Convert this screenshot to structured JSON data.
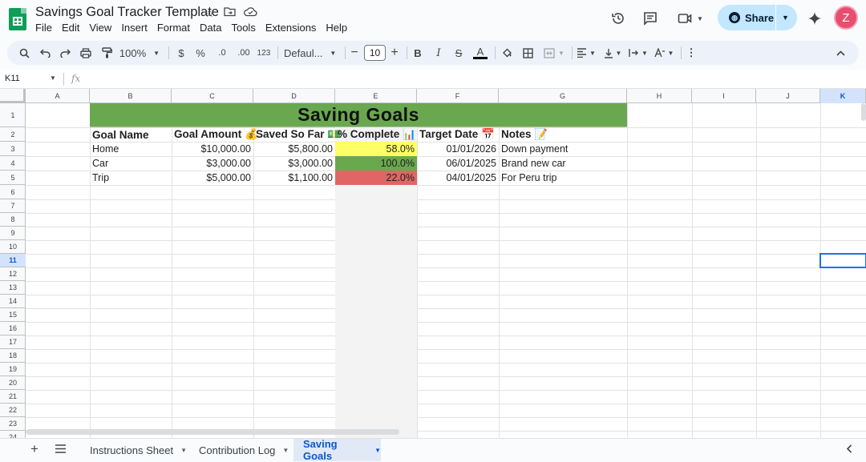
{
  "header": {
    "doc_title": "Savings Goal Tracker Template",
    "menu": [
      "File",
      "Edit",
      "View",
      "Insert",
      "Format",
      "Data",
      "Tools",
      "Extensions",
      "Help"
    ],
    "share_label": "Share",
    "avatar_initial": "Z"
  },
  "toolbar": {
    "zoom": "100%",
    "currency": "$",
    "percent": "%",
    "dec_decrease": ".0",
    "dec_increase": ".00",
    "number_format": "123",
    "font": "Defaul...",
    "font_size": "10"
  },
  "formula_bar": {
    "name_box": "K11",
    "fx": "fx"
  },
  "columns": [
    "A",
    "B",
    "C",
    "D",
    "E",
    "F",
    "G",
    "H",
    "I",
    "J",
    "K"
  ],
  "selected_column": "K",
  "rows": [
    "1",
    "2",
    "3",
    "4",
    "5",
    "6",
    "7",
    "8",
    "9",
    "10",
    "11",
    "12",
    "13",
    "14",
    "15",
    "16",
    "17",
    "18",
    "19",
    "20",
    "21",
    "22",
    "23",
    "24"
  ],
  "selected_row": "11",
  "sheet": {
    "title": "Saving Goals",
    "headers": [
      "Goal Name",
      "Goal Amount 💰",
      "Saved So Far 💵",
      "% Complete 📊",
      "Target Date 📅",
      "Notes 📝"
    ],
    "records": [
      {
        "goal": "Home",
        "amount": "$10,000.00",
        "saved": "$5,800.00",
        "percent": "58.0%",
        "percent_color": "#ffff66",
        "date": "01/01/2026",
        "notes": "Down payment"
      },
      {
        "goal": "Car",
        "amount": "$3,000.00",
        "saved": "$3,000.00",
        "percent": "100.0%",
        "percent_color": "#6aa84f",
        "date": "06/01/2025",
        "notes": "Brand new car"
      },
      {
        "goal": "Trip",
        "amount": "$5,000.00",
        "saved": "$1,100.00",
        "percent": "22.0%",
        "percent_color": "#e06666",
        "date": "04/01/2025",
        "notes": "For Peru trip"
      }
    ]
  },
  "tabs": [
    {
      "label": "Instructions Sheet",
      "active": false
    },
    {
      "label": "Contribution Log",
      "active": false
    },
    {
      "label": "Saving Goals",
      "active": true
    }
  ],
  "colors": {
    "title_band": "#6aa84f",
    "accent": "#0b57d0",
    "share_bg": "#c2e7ff"
  }
}
